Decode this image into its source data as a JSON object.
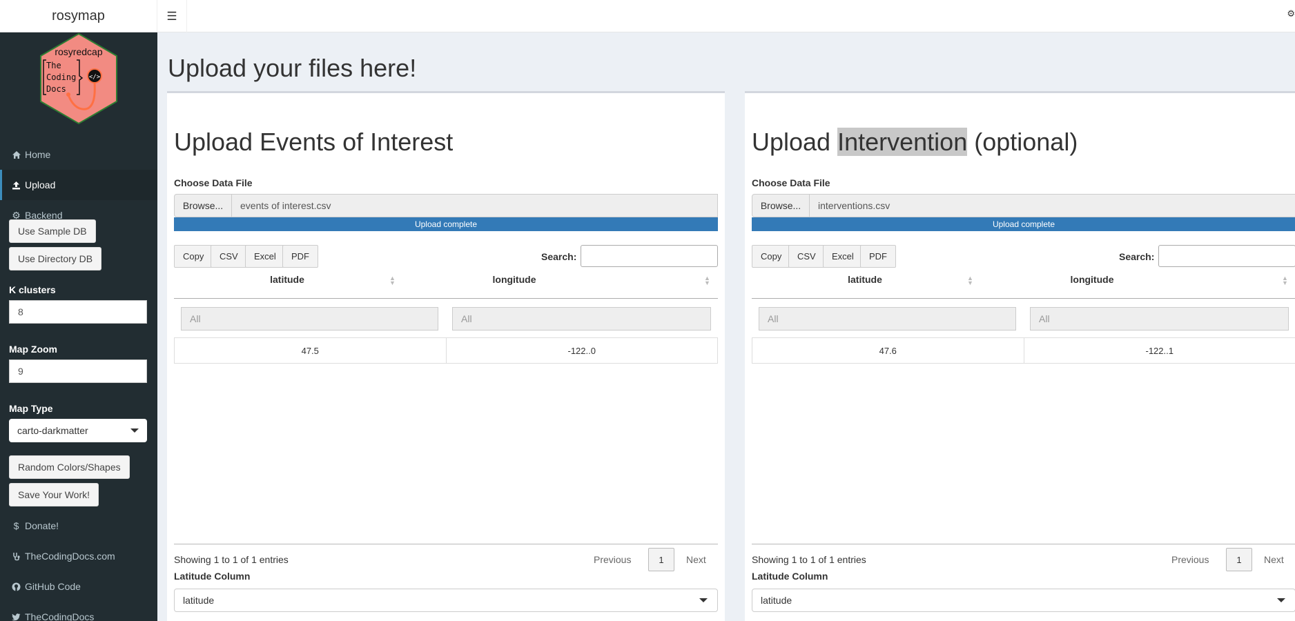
{
  "app": {
    "title": "rosymap"
  },
  "header": {
    "toggle_icon": "hamburger-icon",
    "settings_icon": "gear-icon"
  },
  "sidebar": {
    "logo": {
      "text": "rosyredcap",
      "badge_lines": [
        "The",
        "Coding",
        "Docs"
      ],
      "colors": {
        "fill": "#f28b82",
        "border": "#2e7d32"
      }
    },
    "items": [
      {
        "label": "Home",
        "icon": "home-icon"
      },
      {
        "label": "Upload",
        "icon": "upload-icon",
        "active": true
      },
      {
        "label": "Backend",
        "icon": "gear-icon"
      }
    ],
    "buttons": {
      "sample_db": "Use Sample DB",
      "directory_db": "Use Directory DB",
      "random": "Random Colors/Shapes",
      "save": "Save Your Work!"
    },
    "k_clusters": {
      "label": "K clusters",
      "value": "8"
    },
    "map_zoom": {
      "label": "Map Zoom",
      "value": "9"
    },
    "map_type": {
      "label": "Map Type",
      "value": "carto-darkmatter"
    },
    "links": [
      {
        "label": "Donate!",
        "icon": "dollar-icon"
      },
      {
        "label": "TheCodingDocs.com",
        "icon": "stethoscope-icon"
      },
      {
        "label": "GitHub Code",
        "icon": "github-icon"
      },
      {
        "label": "TheCodingDocs",
        "icon": "twitter-icon"
      }
    ]
  },
  "main": {
    "title": "Upload your files here!",
    "panels": [
      {
        "title_pre": "Upload Events of Interest",
        "title_hl": "",
        "title_post": "",
        "choose_label": "Choose Data File",
        "browse_label": "Browse...",
        "file_name": "events of interest.csv",
        "progress_text": "Upload complete",
        "buttons": [
          "Copy",
          "CSV",
          "Excel",
          "PDF"
        ],
        "search_label": "Search:",
        "columns": [
          "latitude",
          "longitude"
        ],
        "filter_placeholder": "All",
        "rows": [
          [
            "47.5",
            "-122..0"
          ]
        ],
        "info": "Showing 1 to 1 of 1 entries",
        "pagination": {
          "prev": "Previous",
          "page": "1",
          "next": "Next"
        },
        "lat_label": "Latitude Column",
        "lat_value": "latitude"
      },
      {
        "title_pre": "Upload ",
        "title_hl": "Intervention",
        "title_post": " (optional)",
        "choose_label": "Choose Data File",
        "browse_label": "Browse...",
        "file_name": "interventions.csv",
        "progress_text": "Upload complete",
        "buttons": [
          "Copy",
          "CSV",
          "Excel",
          "PDF"
        ],
        "search_label": "Search:",
        "columns": [
          "latitude",
          "longitude"
        ],
        "filter_placeholder": "All",
        "rows": [
          [
            "47.6",
            "-122..1"
          ]
        ],
        "info": "Showing 1 to 1 of 1 entries",
        "pagination": {
          "prev": "Previous",
          "page": "1",
          "next": "Next"
        },
        "lat_label": "Latitude Column",
        "lat_value": "latitude"
      }
    ]
  },
  "colors": {
    "sidebar_bg": "#222d32",
    "progress": "#337ab7",
    "content_bg": "#ecf0f5"
  }
}
